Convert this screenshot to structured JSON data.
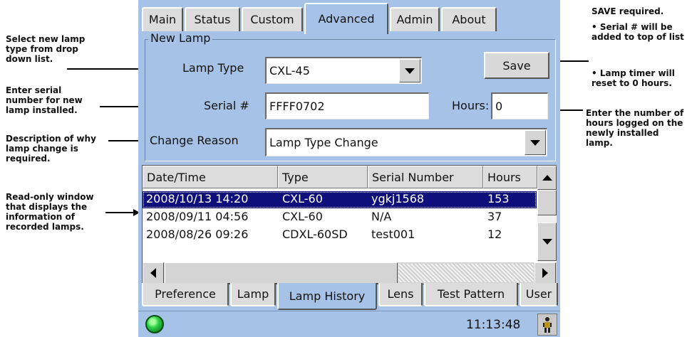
{
  "top_tabs": [
    "Main",
    "Status",
    "Custom",
    "Advanced",
    "Admin",
    "About"
  ],
  "active_top_tab": "Advanced",
  "new_lamp": {
    "group_label": "New Lamp",
    "lamp_type_label": "Lamp Type",
    "lamp_type_value": "CXL-45",
    "save_label": "Save",
    "serial_label": "Serial #",
    "serial_value": "FFFF0702",
    "hours_label": "Hours:",
    "hours_value": "0",
    "change_reason_label": "Change Reason",
    "change_reason_value": "Lamp Type Change"
  },
  "lamp_list": {
    "columns": [
      "Date/Time",
      "Type",
      "Serial Number",
      "Hours"
    ],
    "rows": [
      {
        "datetime": "2008/10/13 14:20",
        "type": "CXL-60",
        "serial": "ygkj1568",
        "hours": "153",
        "selected": true
      },
      {
        "datetime": "2008/09/11 04:56",
        "type": "CXL-60",
        "serial": "N/A",
        "hours": "37",
        "selected": false
      },
      {
        "datetime": "2008/08/26 09:26",
        "type": "CDXL-60SD",
        "serial": "test001",
        "hours": "12",
        "selected": false
      }
    ]
  },
  "bottom_tabs": [
    "Preference",
    "Lamp",
    "Lamp History",
    "Lens",
    "Test Pattern",
    "User"
  ],
  "active_bottom_tab": "Lamp History",
  "status": {
    "time": "11:13:48",
    "indicator_icon": "green-status-led-icon",
    "user_icon": "person-icon"
  },
  "callouts": {
    "select_lamp": "Select new lamp type from drop down list.",
    "enter_serial": "Enter serial number for new lamp installed.",
    "description": "Description of why lamp change is required.",
    "read_only": "Read-only window that displays the information of recorded lamps.",
    "save_required": "SAVE required.",
    "serial_top": "• Serial # will be added to top of list",
    "lamp_timer": "• Lamp timer will reset to 0 hours.",
    "enter_hours": "Enter the number of hours logged on the newly installed lamp."
  },
  "colors": {
    "screen_bg": "#a6c3e7",
    "selection_bg": "#0f0f7c",
    "status_led": "#2fd24a"
  }
}
